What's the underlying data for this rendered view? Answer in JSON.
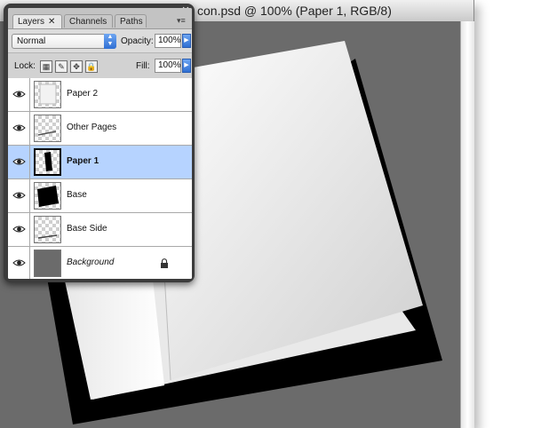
{
  "document": {
    "title": "Icon.psd @ 100% (Paper 1, RGB/8)",
    "visible_title": "con.psd @ 100% (Paper 1, RGB/8)",
    "canvas_color": "#6b6b6b"
  },
  "layers_panel": {
    "tabs": [
      {
        "label": "Layers",
        "active": true
      },
      {
        "label": "Channels",
        "active": false
      },
      {
        "label": "Paths",
        "active": false
      }
    ],
    "blend_mode": "Normal",
    "opacity_label": "Opacity:",
    "opacity_value": "100%",
    "lock_label": "Lock:",
    "fill_label": "Fill:",
    "fill_value": "100%",
    "layers": [
      {
        "name": "Paper 2",
        "visible": true,
        "selected": false,
        "thumb": "paper-light"
      },
      {
        "name": "Other Pages",
        "visible": true,
        "selected": false,
        "thumb": "transparent-stroke"
      },
      {
        "name": "Paper 1",
        "visible": true,
        "selected": true,
        "thumb": "paper-dark"
      },
      {
        "name": "Base",
        "visible": true,
        "selected": false,
        "thumb": "black-square"
      },
      {
        "name": "Base Side",
        "visible": true,
        "selected": false,
        "thumb": "transparent-stroke"
      },
      {
        "name": "Background",
        "visible": true,
        "selected": false,
        "thumb": "gray",
        "locked": true,
        "italic": true
      }
    ],
    "selection_color": "#b6d3ff"
  }
}
